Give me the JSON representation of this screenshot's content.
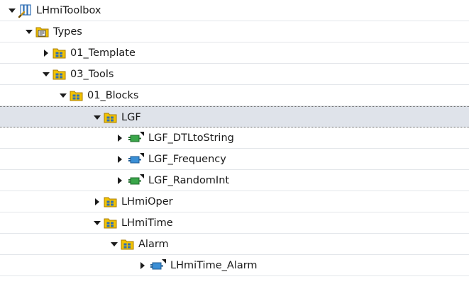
{
  "tree": {
    "nodes": [
      {
        "label": "LHmiToolbox",
        "icon": "library-icon",
        "expanded": true
      },
      {
        "label": "Types",
        "icon": "types-folder-icon",
        "expanded": true
      },
      {
        "label": "01_Template",
        "icon": "folder-icon",
        "expanded": false
      },
      {
        "label": "03_Tools",
        "icon": "folder-icon",
        "expanded": true
      },
      {
        "label": "01_Blocks",
        "icon": "folder-icon",
        "expanded": true
      },
      {
        "label": "LGF",
        "icon": "folder-icon",
        "expanded": true,
        "selected": true
      },
      {
        "label": "LGF_DTLtoString",
        "icon": "function-block-green-icon",
        "expanded": false
      },
      {
        "label": "LGF_Frequency",
        "icon": "function-block-blue-icon",
        "expanded": false
      },
      {
        "label": "LGF_RandomInt",
        "icon": "function-block-green-icon",
        "expanded": false
      },
      {
        "label": "LHmiOper",
        "icon": "folder-icon",
        "expanded": false
      },
      {
        "label": "LHmiTime",
        "icon": "folder-icon",
        "expanded": true
      },
      {
        "label": "Alarm",
        "icon": "folder-icon",
        "expanded": true
      },
      {
        "label": "LHmiTime_Alarm",
        "icon": "function-block-blue-icon",
        "expanded": false
      }
    ]
  },
  "colors": {
    "folder": "#f2c200",
    "folder_outline": "#a97d00",
    "block_green": "#3aa64a",
    "block_blue": "#3a8fd6",
    "selected_row": "#dfe3ea",
    "row_divider": "#e3e6ea"
  }
}
